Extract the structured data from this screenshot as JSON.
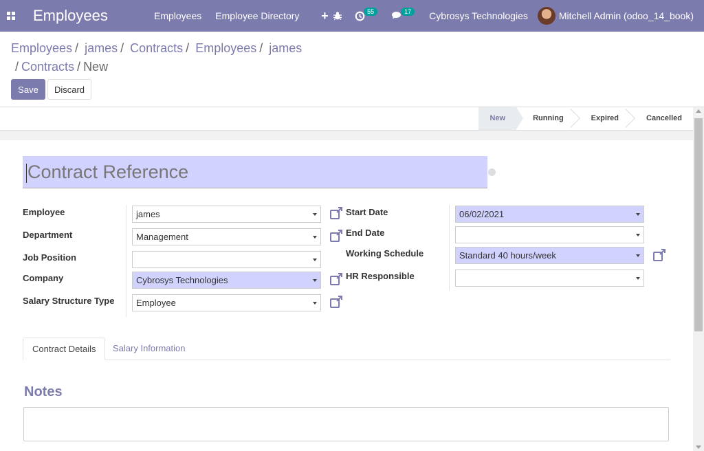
{
  "navbar": {
    "app_title": "Employees",
    "menu": [
      "Employees",
      "Employee Directory"
    ],
    "plus_symbol": "+",
    "activity_count": "55",
    "messages_count": "17",
    "company": "Cybrosys Technologies",
    "user": "Mitchell Admin (odoo_14_book)",
    "accent_color": "#7c7bad"
  },
  "breadcrumb": {
    "items": [
      "Employees",
      "james",
      "Contracts",
      "Employees",
      "james",
      "Contracts"
    ],
    "current": "New"
  },
  "buttons": {
    "save": "Save",
    "discard": "Discard"
  },
  "status": {
    "stages": [
      "New",
      "Running",
      "Expired",
      "Cancelled"
    ],
    "current": "New"
  },
  "form": {
    "reference_placeholder": "Contract Reference",
    "left": [
      {
        "label": "Employee",
        "value": "james",
        "required": false,
        "external": true
      },
      {
        "label": "Department",
        "value": "Management",
        "required": false,
        "external": true
      },
      {
        "label": "Job Position",
        "value": "",
        "required": false,
        "external": false
      },
      {
        "label": "Company",
        "value": "Cybrosys Technologies",
        "required": true,
        "external": true
      },
      {
        "label": "Salary Structure Type",
        "value": "Employee",
        "required": false,
        "external": true
      }
    ],
    "right": [
      {
        "label": "Start Date",
        "value": "06/02/2021",
        "required": true,
        "external": false
      },
      {
        "label": "End Date",
        "value": "",
        "required": false,
        "external": false
      },
      {
        "label": "Working Schedule",
        "value": "Standard 40 hours/week",
        "required": true,
        "external": true
      },
      {
        "label": "HR Responsible",
        "value": "",
        "required": false,
        "external": false
      }
    ]
  },
  "tabs": [
    "Contract Details",
    "Salary Information"
  ],
  "notes": {
    "title": "Notes"
  }
}
